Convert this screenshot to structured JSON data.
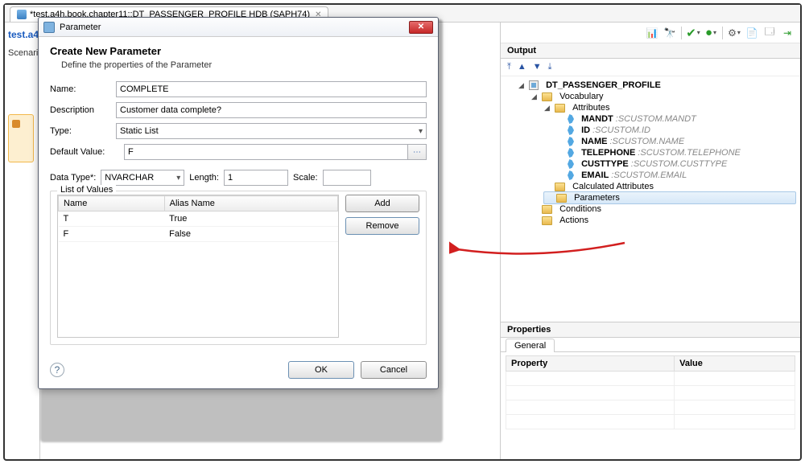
{
  "tab": {
    "title": "*test.a4h.book.chapter11::DT_PASSENGER_PROFILE HDB (SAPH74)"
  },
  "leftcol": {
    "testlabel": "test.a4",
    "scenario": "Scenario"
  },
  "dialog": {
    "windowTitle": "Parameter",
    "heading": "Create New Parameter",
    "subheading": "Define the properties of the Parameter",
    "labels": {
      "name": "Name:",
      "description": "Description",
      "type": "Type:",
      "defaultValue": "Default Value:",
      "dataType": "Data Type*:",
      "length": "Length:",
      "scale": "Scale:"
    },
    "values": {
      "name": "COMPLETE",
      "description": "Customer data complete?",
      "type": "Static List",
      "defaultValue": "F",
      "dataType": "NVARCHAR",
      "length": "1",
      "scale": ""
    },
    "lov": {
      "groupLabel": "List of Values",
      "cols": {
        "name": "Name",
        "alias": "Alias Name"
      },
      "rows": [
        {
          "name": "T",
          "alias": "True"
        },
        {
          "name": "F",
          "alias": "False"
        }
      ],
      "add": "Add",
      "remove": "Remove"
    },
    "buttons": {
      "ok": "OK",
      "cancel": "Cancel"
    }
  },
  "output": {
    "title": "Output",
    "root": "DT_PASSENGER_PROFILE",
    "vocabulary": "Vocabulary",
    "attributesLabel": "Attributes",
    "attributes": [
      {
        "name": "MANDT",
        "src": "SCUSTOM.MANDT"
      },
      {
        "name": "ID",
        "src": "SCUSTOM.ID"
      },
      {
        "name": "NAME",
        "src": "SCUSTOM.NAME"
      },
      {
        "name": "TELEPHONE",
        "src": "SCUSTOM.TELEPHONE"
      },
      {
        "name": "CUSTTYPE",
        "src": "SCUSTOM.CUSTTYPE"
      },
      {
        "name": "EMAIL",
        "src": "SCUSTOM.EMAIL"
      }
    ],
    "calcAttr": "Calculated Attributes",
    "parameters": "Parameters",
    "conditions": "Conditions",
    "actions": "Actions"
  },
  "properties": {
    "title": "Properties",
    "tab": "General",
    "cols": {
      "property": "Property",
      "value": "Value"
    }
  }
}
